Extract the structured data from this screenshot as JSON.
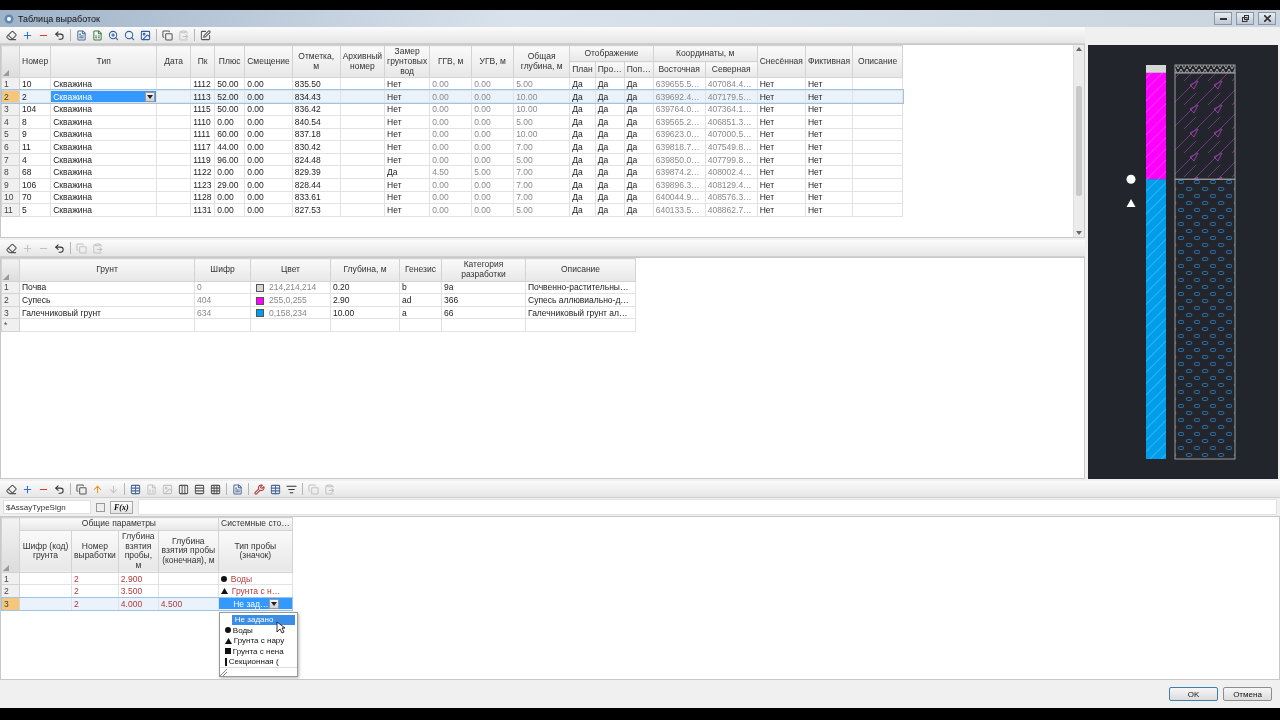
{
  "window": {
    "title": "Таблица выработок"
  },
  "workings_toolbar": [
    {
      "kind": "eraser",
      "disabled": false
    },
    {
      "kind": "add",
      "disabled": false
    },
    {
      "kind": "remove",
      "disabled": false
    },
    {
      "kind": "undo",
      "disabled": false
    },
    {
      "kind": "separator"
    },
    {
      "kind": "document",
      "disabled": false
    },
    {
      "kind": "sheet",
      "disabled": false
    },
    {
      "kind": "zoom",
      "disabled": false
    },
    {
      "kind": "search",
      "disabled": false
    },
    {
      "kind": "image",
      "disabled": false
    },
    {
      "kind": "separator"
    },
    {
      "kind": "copy",
      "disabled": false
    },
    {
      "kind": "paste",
      "disabled": true
    },
    {
      "kind": "separator"
    },
    {
      "kind": "edit",
      "disabled": false
    }
  ],
  "workings_table": {
    "columns": [
      {
        "label": "Номер"
      },
      {
        "label": "Тип",
        "kind": "combo"
      },
      {
        "label": "Дата"
      },
      {
        "label": "Пк"
      },
      {
        "label": "Плюс"
      },
      {
        "label": "Смещение"
      },
      {
        "label": "Отметка, м"
      },
      {
        "label": "Архивный номер"
      },
      {
        "label": "Замер грунтовых вод"
      },
      {
        "label": "ГГВ, м",
        "readonly": true
      },
      {
        "label": "УГВ, м",
        "readonly": true
      },
      {
        "label": "Общая глубина, м",
        "readonly": true
      },
      {
        "label": "Отображение",
        "colspan": 3,
        "children": [
          {
            "label": "План"
          },
          {
            "label": "Про…"
          },
          {
            "label": "Поп…"
          }
        ]
      },
      {
        "label": "Координаты, м",
        "colspan": 2,
        "children": [
          {
            "label": "Восточная",
            "readonly": true
          },
          {
            "label": "Северная",
            "readonly": true
          }
        ]
      },
      {
        "label": "Снесённая"
      },
      {
        "label": "Фиктивная"
      },
      {
        "label": "Описание"
      }
    ],
    "rows": [
      {
        "num": "1",
        "selected": false,
        "cells": [
          "10",
          "Скважина",
          null,
          "1112",
          "50.00",
          "0.00",
          "835.50",
          null,
          "Нет",
          "0.00",
          "0.00",
          "5.00",
          "Да",
          "Да",
          "Да",
          "639655.5…",
          "407084.4…",
          "Нет",
          "Нет",
          null
        ]
      },
      {
        "num": "2",
        "selected": true,
        "cells": [
          "2",
          "Скважина",
          null,
          "1113",
          "52.00",
          "0.00",
          "834.43",
          null,
          "Нет",
          "0.00",
          "0.00",
          "10.00",
          "Да",
          "Да",
          "Да",
          "639692.4…",
          "407179.5…",
          "Нет",
          "Нет",
          null
        ]
      },
      {
        "num": "3",
        "selected": false,
        "cells": [
          "104",
          "Скважина",
          null,
          "1115",
          "50.00",
          "0.00",
          "836.42",
          null,
          "Нет",
          "0.00",
          "0.00",
          "10.00",
          "Да",
          "Да",
          "Да",
          "639764.0…",
          "407364.1…",
          "Нет",
          "Нет",
          null
        ]
      },
      {
        "num": "4",
        "selected": false,
        "cells": [
          "8",
          "Скважина",
          null,
          "1110",
          "0.00",
          "0.00",
          "840.54",
          null,
          "Нет",
          "0.00",
          "0.00",
          "5.00",
          "Да",
          "Да",
          "Да",
          "639565.2…",
          "406851.3…",
          "Нет",
          "Нет",
          null
        ]
      },
      {
        "num": "5",
        "selected": false,
        "cells": [
          "9",
          "Скважина",
          null,
          "1111",
          "60.00",
          "0.00",
          "837.18",
          null,
          "Нет",
          "0.00",
          "0.00",
          "10.00",
          "Да",
          "Да",
          "Да",
          "639623.0…",
          "407000.5…",
          "Нет",
          "Нет",
          null
        ]
      },
      {
        "num": "6",
        "selected": false,
        "cells": [
          "11",
          "Скважина",
          null,
          "1117",
          "44.00",
          "0.00",
          "830.42",
          null,
          "Нет",
          "0.00",
          "0.00",
          "7.00",
          "Да",
          "Да",
          "Да",
          "639818.7…",
          "407549.8…",
          "Нет",
          "Нет",
          null
        ]
      },
      {
        "num": "7",
        "selected": false,
        "cells": [
          "4",
          "Скважина",
          null,
          "1119",
          "96.00",
          "0.00",
          "824.48",
          null,
          "Нет",
          "0.00",
          "0.00",
          "5.00",
          "Да",
          "Да",
          "Да",
          "639850.0…",
          "407799.8…",
          "Нет",
          "Нет",
          null
        ]
      },
      {
        "num": "8",
        "selected": false,
        "cells": [
          "68",
          "Скважина",
          null,
          "1122",
          "0.00",
          "0.00",
          "829.39",
          null,
          "Да",
          "4.50",
          "5.00",
          "7.00",
          "Да",
          "Да",
          "Да",
          "639874.2…",
          "408002.4…",
          "Нет",
          "Нет",
          null
        ]
      },
      {
        "num": "9",
        "selected": false,
        "cells": [
          "106",
          "Скважина",
          null,
          "1123",
          "29.00",
          "0.00",
          "828.44",
          null,
          "Нет",
          "0.00",
          "0.00",
          "7.00",
          "Да",
          "Да",
          "Да",
          "639896.3…",
          "408129.4…",
          "Нет",
          "Нет",
          null
        ]
      },
      {
        "num": "10",
        "selected": false,
        "cells": [
          "70",
          "Скважина",
          null,
          "1128",
          "0.00",
          "0.00",
          "833.61",
          null,
          "Нет",
          "0.00",
          "0.00",
          "7.00",
          "Да",
          "Да",
          "Да",
          "640044.9…",
          "408576.3…",
          "Нет",
          "Нет",
          null
        ]
      },
      {
        "num": "11",
        "selected": false,
        "cells": [
          "5",
          "Скважина",
          null,
          "1131",
          "0.00",
          "0.00",
          "827.53",
          null,
          "Нет",
          "0.00",
          "0.00",
          "5.00",
          "Да",
          "Да",
          "Да",
          "640133.5…",
          "408862.7…",
          "Нет",
          "Нет",
          null
        ]
      }
    ]
  },
  "layers_toolbar": [
    {
      "kind": "eraser",
      "disabled": false
    },
    {
      "kind": "add",
      "disabled": true
    },
    {
      "kind": "remove",
      "disabled": true
    },
    {
      "kind": "undo",
      "disabled": false
    },
    {
      "kind": "separator"
    },
    {
      "kind": "copy",
      "disabled": true
    },
    {
      "kind": "paste",
      "disabled": true
    }
  ],
  "layers_table": {
    "columns": [
      {
        "label": "Грунт"
      },
      {
        "label": "Шифр",
        "readonly": true
      },
      {
        "label": "Цвет",
        "kind": "color"
      },
      {
        "label": "Глубина, м"
      },
      {
        "label": "Генезис"
      },
      {
        "label": "Категория разработки"
      },
      {
        "label": "Описание"
      }
    ],
    "rows": [
      {
        "num": "1",
        "cells": [
          "Почва",
          "0",
          {
            "color": "#d6d6d6",
            "text": "214,214,214"
          },
          "0.20",
          "b",
          "9а",
          "Почвенно-растительны…"
        ]
      },
      {
        "num": "2",
        "cells": [
          "Супесь",
          "404",
          {
            "color": "#ff00ff",
            "text": "255,0,255"
          },
          "2.90",
          "ad",
          "366",
          "Супесь аллювиально-д…"
        ]
      },
      {
        "num": "3",
        "cells": [
          "Галечниковый грунт",
          "634",
          {
            "color": "#009eea",
            "text": "0,158,234"
          },
          "10.00",
          "a",
          "66",
          "Галечниковый грунт ал…"
        ]
      }
    ],
    "new_row_marker": "*"
  },
  "samples_toolbar": [
    {
      "kind": "eraser",
      "disabled": false
    },
    {
      "kind": "add",
      "disabled": false
    },
    {
      "kind": "remove",
      "disabled": false
    },
    {
      "kind": "undo",
      "disabled": false
    },
    {
      "kind": "separator"
    },
    {
      "kind": "copy",
      "disabled": false
    },
    {
      "kind": "up",
      "disabled": false
    },
    {
      "kind": "down",
      "disabled": true
    },
    {
      "kind": "separator"
    },
    {
      "kind": "table",
      "disabled": false
    },
    {
      "kind": "sheet",
      "disabled": true
    },
    {
      "kind": "image",
      "disabled": true
    },
    {
      "kind": "columns",
      "disabled": false
    },
    {
      "kind": "rows",
      "disabled": false
    },
    {
      "kind": "grid",
      "disabled": false
    },
    {
      "kind": "separator"
    },
    {
      "kind": "document",
      "disabled": false
    },
    {
      "kind": "separator"
    },
    {
      "kind": "wrench",
      "disabled": false
    },
    {
      "kind": "table",
      "disabled": false
    },
    {
      "kind": "filter",
      "disabled": false
    },
    {
      "kind": "separator"
    },
    {
      "kind": "copy",
      "disabled": true
    },
    {
      "kind": "paste",
      "disabled": true
    }
  ],
  "formula_bar": {
    "field": "$AssayTypeSign",
    "fx_label": "F(x)"
  },
  "samples_table": {
    "columns": [
      {
        "label": "Общие параметры",
        "colspan": 4,
        "children": [
          {
            "label": "Шифр (код) грунта"
          },
          {
            "label": "Номер выработки"
          },
          {
            "label": "Глубина взятия пробы, м"
          },
          {
            "label": "Глубина взятия пробы (конечная), м"
          }
        ]
      },
      {
        "label": "Системные сто…",
        "children": [
          {
            "label": "Тип пробы (значок)",
            "kind": "sign"
          }
        ]
      }
    ],
    "rows": [
      {
        "num": "1",
        "selected": false,
        "cells": [
          null,
          "2",
          "2.900",
          null,
          {
            "kind": "circle",
            "label": "Воды"
          }
        ]
      },
      {
        "num": "2",
        "selected": false,
        "cells": [
          null,
          "2",
          "3.500",
          null,
          {
            "kind": "triangle",
            "label": "Грунта с н…"
          }
        ]
      },
      {
        "num": "3",
        "selected": true,
        "cells": [
          null,
          "2",
          "4.000",
          "4.500",
          {
            "kind": "none",
            "label": "Не зад…"
          }
        ]
      }
    ],
    "sign_dropdown": [
      {
        "kind": "none",
        "label": "Не задано",
        "selected": true
      },
      {
        "kind": "circle",
        "label": "Воды",
        "selected": false
      },
      {
        "kind": "triangle",
        "label": "Грунта с нару",
        "selected": false
      },
      {
        "kind": "square",
        "label": "Грунта с нена",
        "selected": false
      },
      {
        "kind": "bar",
        "label": "Секционная (",
        "selected": false
      }
    ]
  },
  "buttons": [
    {
      "label": "OK",
      "default": true
    },
    {
      "label": "Отмена",
      "default": false
    }
  ]
}
